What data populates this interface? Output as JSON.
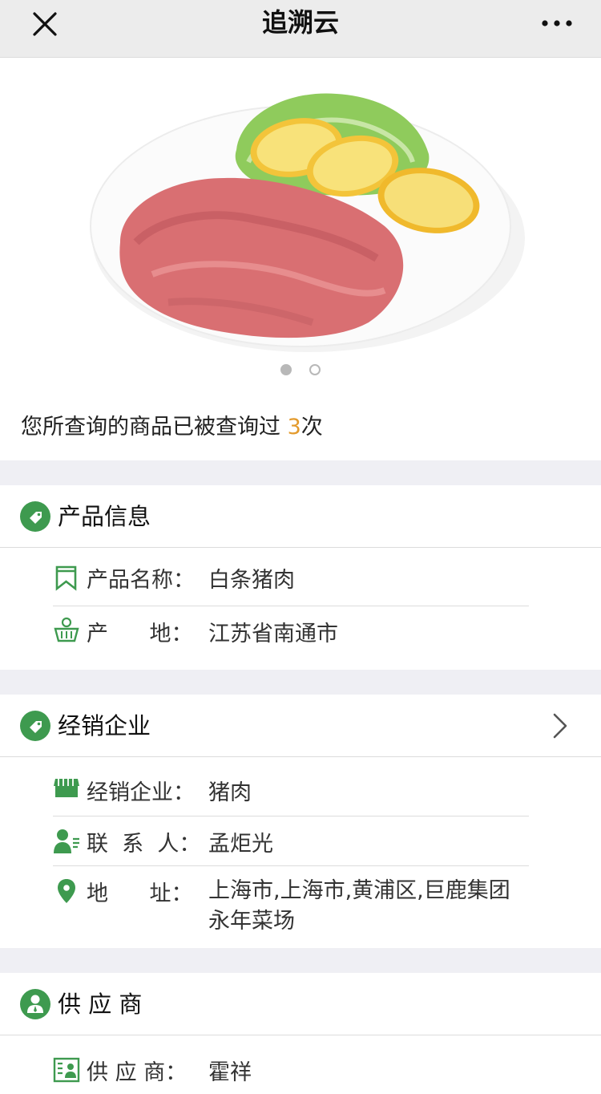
{
  "colors": {
    "accent_green": "#3e9a4f",
    "count_orange": "#e39a2c"
  },
  "header": {
    "title": "追溯云",
    "close_icon": "close-icon",
    "more_icon": "more-dots-icon"
  },
  "carousel": {
    "image": "plate-of-minced-pork-with-lemon-slices",
    "total_slides": 2,
    "active_slide": 1
  },
  "query_notice": {
    "text": "您所查询的商品已被查询过 ",
    "count": "3",
    "suffix": "次"
  },
  "product_info": {
    "title": "产品信息",
    "icon": "tag-icon",
    "rows": [
      {
        "icon": "bookmark-icon",
        "label": "产品名称：",
        "value": "白条猪肉"
      },
      {
        "icon": "origin-basket-icon",
        "label": "产      地：",
        "value": "江苏省南通市"
      }
    ]
  },
  "distributor": {
    "title": "经销企业",
    "icon": "tag-icon",
    "chevron": "chevron-right-icon",
    "rows": [
      {
        "icon": "store-icon",
        "label": "经销企业：",
        "value": "猪肉"
      },
      {
        "icon": "contact-person-icon",
        "label": "联  系  人：",
        "value": "孟炬光"
      },
      {
        "icon": "location-pin-icon",
        "label": "地      址：",
        "value": "上海市,上海市,黄浦区,巨鹿集团永年菜场"
      }
    ]
  },
  "supplier": {
    "title": "供 应 商",
    "icon": "person-badge-icon",
    "rows": [
      {
        "icon": "id-card-icon",
        "label": "供 应 商：",
        "value": "霍祥"
      }
    ]
  }
}
